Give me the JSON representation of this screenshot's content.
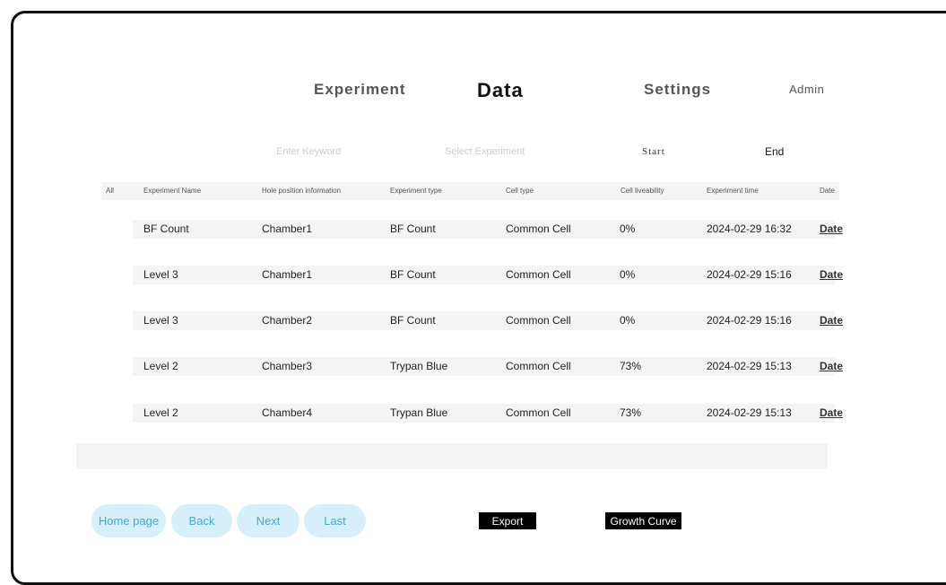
{
  "nav": {
    "experiment": "Experiment",
    "data": "Data",
    "settings": "Settings",
    "admin": "Admin"
  },
  "filters": {
    "keyword_placeholder": "Enter Keyword",
    "experiment_placeholder": "Select Experiment",
    "start": "Start",
    "end": "End"
  },
  "table": {
    "headers": [
      "All",
      "Experiment Name",
      "Hole position information",
      "Experiment type",
      "Cell type",
      "Cell liveability",
      "Experiment time",
      "Date"
    ],
    "rows": [
      {
        "name": "BF Count",
        "hole": "Chamber1",
        "type": "BF Count",
        "cell": "Common Cell",
        "live": "0%",
        "time": "2024-02-29 16:32",
        "date": "Date"
      },
      {
        "name": "Level 3",
        "hole": "Chamber1",
        "type": "BF Count",
        "cell": "Common Cell",
        "live": "0%",
        "time": "2024-02-29 15:16",
        "date": "Date"
      },
      {
        "name": "Level 3",
        "hole": "Chamber2",
        "type": "BF Count",
        "cell": "Common Cell",
        "live": "0%",
        "time": "2024-02-29 15:16",
        "date": "Date"
      },
      {
        "name": "Level 2",
        "hole": "Chamber3",
        "type": "Trypan Blue",
        "cell": "Common Cell",
        "live": "73%",
        "time": "2024-02-29 15:13",
        "date": "Date"
      },
      {
        "name": "Level 2",
        "hole": "Chamber4",
        "type": "Trypan Blue",
        "cell": "Common Cell",
        "live": "73%",
        "time": "2024-02-29 15:13",
        "date": "Date"
      }
    ]
  },
  "pager": {
    "home": "Home page",
    "back": "Back",
    "next": "Next",
    "last": "Last"
  },
  "actions": {
    "export": "Export",
    "growth_curve": "Growth Curve"
  },
  "colors": {
    "pill_bg": "#d6effa",
    "pill_text": "#47a6d2",
    "row_bg": "#f4f4f5"
  }
}
